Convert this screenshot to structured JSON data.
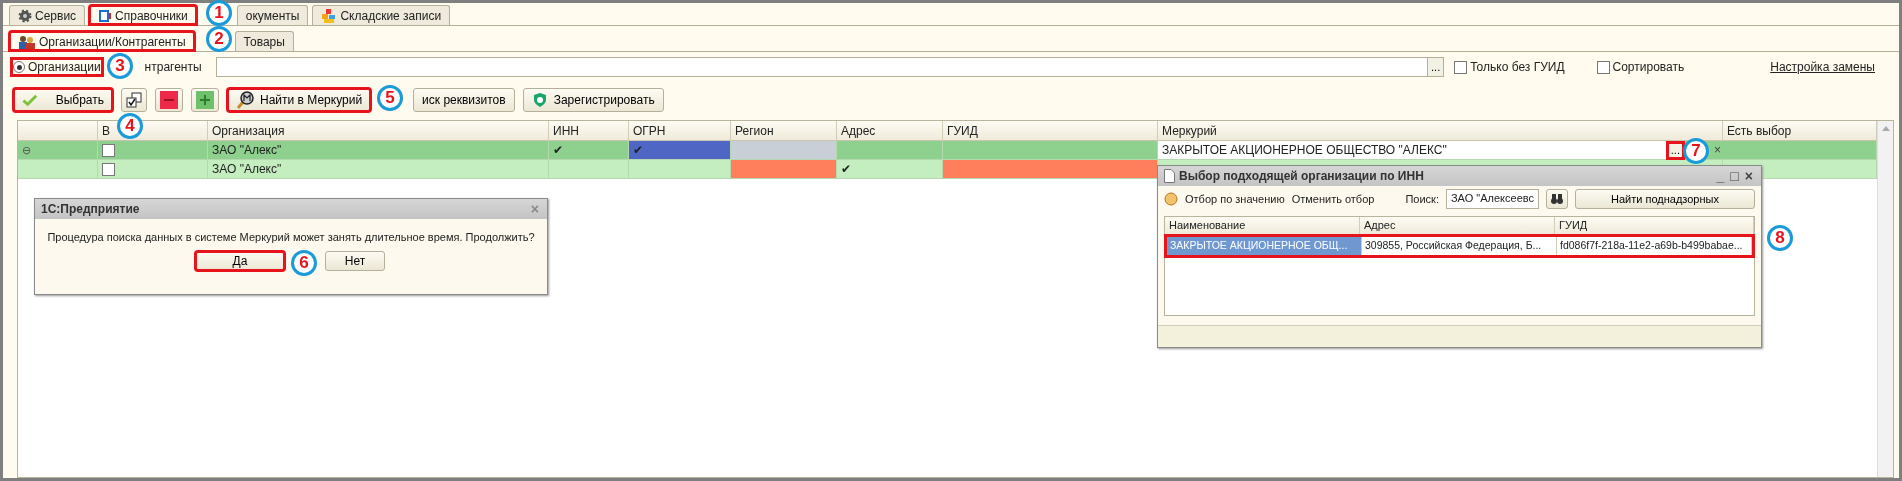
{
  "main_tabs": [
    {
      "label": "Сервис",
      "selected": false,
      "highlighted": false
    },
    {
      "label": "Справочники",
      "selected": true,
      "highlighted": true
    },
    {
      "label": "окументы",
      "selected": false,
      "highlighted": false
    },
    {
      "label": "Складские записи",
      "selected": false,
      "highlighted": false
    }
  ],
  "sub_tabs": [
    {
      "label": "Организации/Контрагенты",
      "selected": true,
      "highlighted": true
    },
    {
      "label": "Товары",
      "selected": false,
      "highlighted": false
    }
  ],
  "mode": {
    "radio": {
      "label": "Организации",
      "selected": true,
      "highlighted": true
    },
    "second_label": "нтрагенты"
  },
  "filter": {
    "button": "..."
  },
  "checkboxes": [
    {
      "label": "Только без ГУИД",
      "checked": false
    },
    {
      "label": "Сортировать",
      "checked": false
    }
  ],
  "link": "Настройка замены",
  "toolbar": [
    {
      "kind": "text",
      "label": "Выбрать",
      "highlighted": true
    },
    {
      "kind": "icon",
      "highlighted": false
    },
    {
      "kind": "icon",
      "highlighted": false
    },
    {
      "kind": "icon",
      "highlighted": false
    },
    {
      "kind": "text",
      "label": "Найти в Меркурий",
      "highlighted": true
    },
    {
      "kind": "text",
      "label": "иск реквизитов",
      "highlighted": false
    },
    {
      "kind": "text",
      "label": "Зарегистрировать",
      "highlighted": false
    }
  ],
  "table": {
    "columns": [
      "",
      "В",
      "Организация",
      "ИНН",
      "ОГРН",
      "Регион",
      "Адрес",
      "ГУИД",
      "Меркурий",
      "Есть выбор"
    ],
    "rows": [
      {
        "color": "#8ed08e",
        "cells": [
          {
            "kind": "expander",
            "text": "⊖"
          },
          {
            "kind": "checkbox",
            "checked": false
          },
          {
            "kind": "text",
            "text": "ЗАО \"Алекс\""
          },
          {
            "kind": "text",
            "text": "✔"
          },
          {
            "kind": "text",
            "text": "✔",
            "color": "#4f66c4"
          },
          {
            "kind": "text",
            "color": "#c8cfd6"
          },
          {
            "kind": "text"
          },
          {
            "kind": "text"
          },
          {
            "kind": "editor",
            "text": "ЗАКРЫТОЕ АКЦИОНЕРНОЕ ОБЩЕСТВО \"АЛЕКС\"",
            "button": "...",
            "highlighted": true,
            "clear": "×"
          },
          {
            "kind": "text"
          }
        ]
      },
      {
        "color": "#c5eec0",
        "cells": [
          {
            "kind": "text"
          },
          {
            "kind": "checkbox",
            "checked": false
          },
          {
            "kind": "text",
            "text": "ЗАО \"Алекс\""
          },
          {
            "kind": "text"
          },
          {
            "kind": "text"
          },
          {
            "kind": "text",
            "color": "#ff7f5c"
          },
          {
            "kind": "text",
            "text": "✔"
          },
          {
            "kind": "text",
            "color": "#ff7f5c"
          },
          {
            "kind": "text"
          },
          {
            "kind": "text"
          }
        ]
      }
    ]
  },
  "dialog": {
    "title": "1С:Предприятие",
    "close": "×",
    "message": "Процедура поиска данных в системе Меркурий может занять длительное время. Продолжить?",
    "buttons": [
      {
        "label": "Да",
        "highlighted": true
      },
      {
        "label": "Нет",
        "highlighted": false
      }
    ]
  },
  "popup": {
    "title": "Выбор подходящей организации по ИНН",
    "controls": [
      "_",
      "□",
      "×"
    ],
    "toolbar": {
      "filter": "Отбор по значению",
      "cancel": "Отменить отбор",
      "search_label": "Поиск:",
      "search_value": "ЗАО \"Алексеевс",
      "find": "Найти поднадзорных"
    },
    "columns": [
      "Наименование",
      "Адрес",
      "ГУИД"
    ],
    "rows": [
      {
        "selected": true,
        "highlighted": true,
        "cells": [
          "ЗАКРЫТОЕ АКЦИОНЕРНОЕ ОБЩ...",
          "309855, Российская Федерация, Б...",
          "fd086f7f-218a-11e2-a69b-b499babae..."
        ]
      }
    ]
  },
  "callouts": [
    "1",
    "2",
    "3",
    "4",
    "5",
    "6",
    "7",
    "8"
  ]
}
